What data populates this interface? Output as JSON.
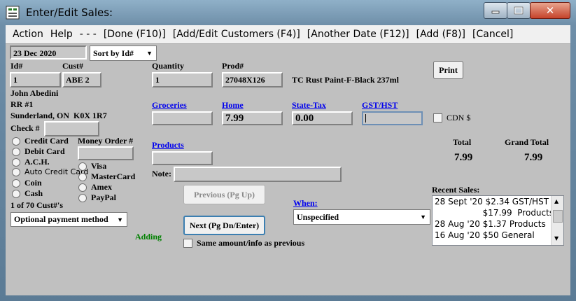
{
  "window": {
    "title": "Enter/Edit Sales:"
  },
  "menu": [
    "Action",
    "Help",
    "- - -",
    "[Done (F10)]",
    "[Add/Edit Customers (F4)]",
    "[Another Date (F12)]",
    "[Add (F8)]",
    "[Cancel]"
  ],
  "header": {
    "date": "23 Dec 2020",
    "sort": "Sort by Id#"
  },
  "labels": {
    "id": "Id#",
    "cust": "Cust#",
    "quantity": "Quantity",
    "prod": "Prod#",
    "check": "Check #",
    "money_order": "Money Order #",
    "note": "Note:",
    "total": "Total",
    "grand_total": "Grand Total",
    "cdn": "CDN $",
    "recent": "Recent Sales:",
    "adding": "Adding",
    "same_info": "Same amount/info as previous",
    "cust_count": "1 of 70 Cust#'s"
  },
  "values": {
    "id": "1",
    "cust": "ABE  2",
    "quantity": "1",
    "prod": "27048X126",
    "product_desc": "TC Rust Paint-F-Black 237ml",
    "home": "7.99",
    "state_tax": "0.00",
    "total": "7.99",
    "grand_total": "7.99"
  },
  "customer": {
    "name": "John Abedini",
    "address1": "RR #1",
    "address2": "Sunderland, ON  K0X 1R7"
  },
  "links": {
    "groceries": "Groceries",
    "home": "Home",
    "state_tax": "State-Tax",
    "gst": "GST/HST",
    "products": "Products",
    "when": "When:"
  },
  "payment_methods": [
    "Credit Card",
    "Debit Card",
    "A.C.H.",
    "Auto Credit Card",
    "Coin",
    "Cash"
  ],
  "card_types": [
    "Visa",
    "MasterCard",
    "Amex",
    "PayPal"
  ],
  "buttons": {
    "print": "Print",
    "previous": "Previous (Pg Up)",
    "next": "Next (Pg Dn/Enter)"
  },
  "dropdowns": {
    "payment": "Optional payment method",
    "when": "Unspecified"
  },
  "recent_sales": [
    "28 Sept '20  $2.34  GST/HST",
    "                  $17.99  Products",
    "28 Aug '20  $1.37  Products",
    "16 Aug '20  $50  General"
  ],
  "colors": {
    "adding": "#008000",
    "link": "#0000ee"
  }
}
